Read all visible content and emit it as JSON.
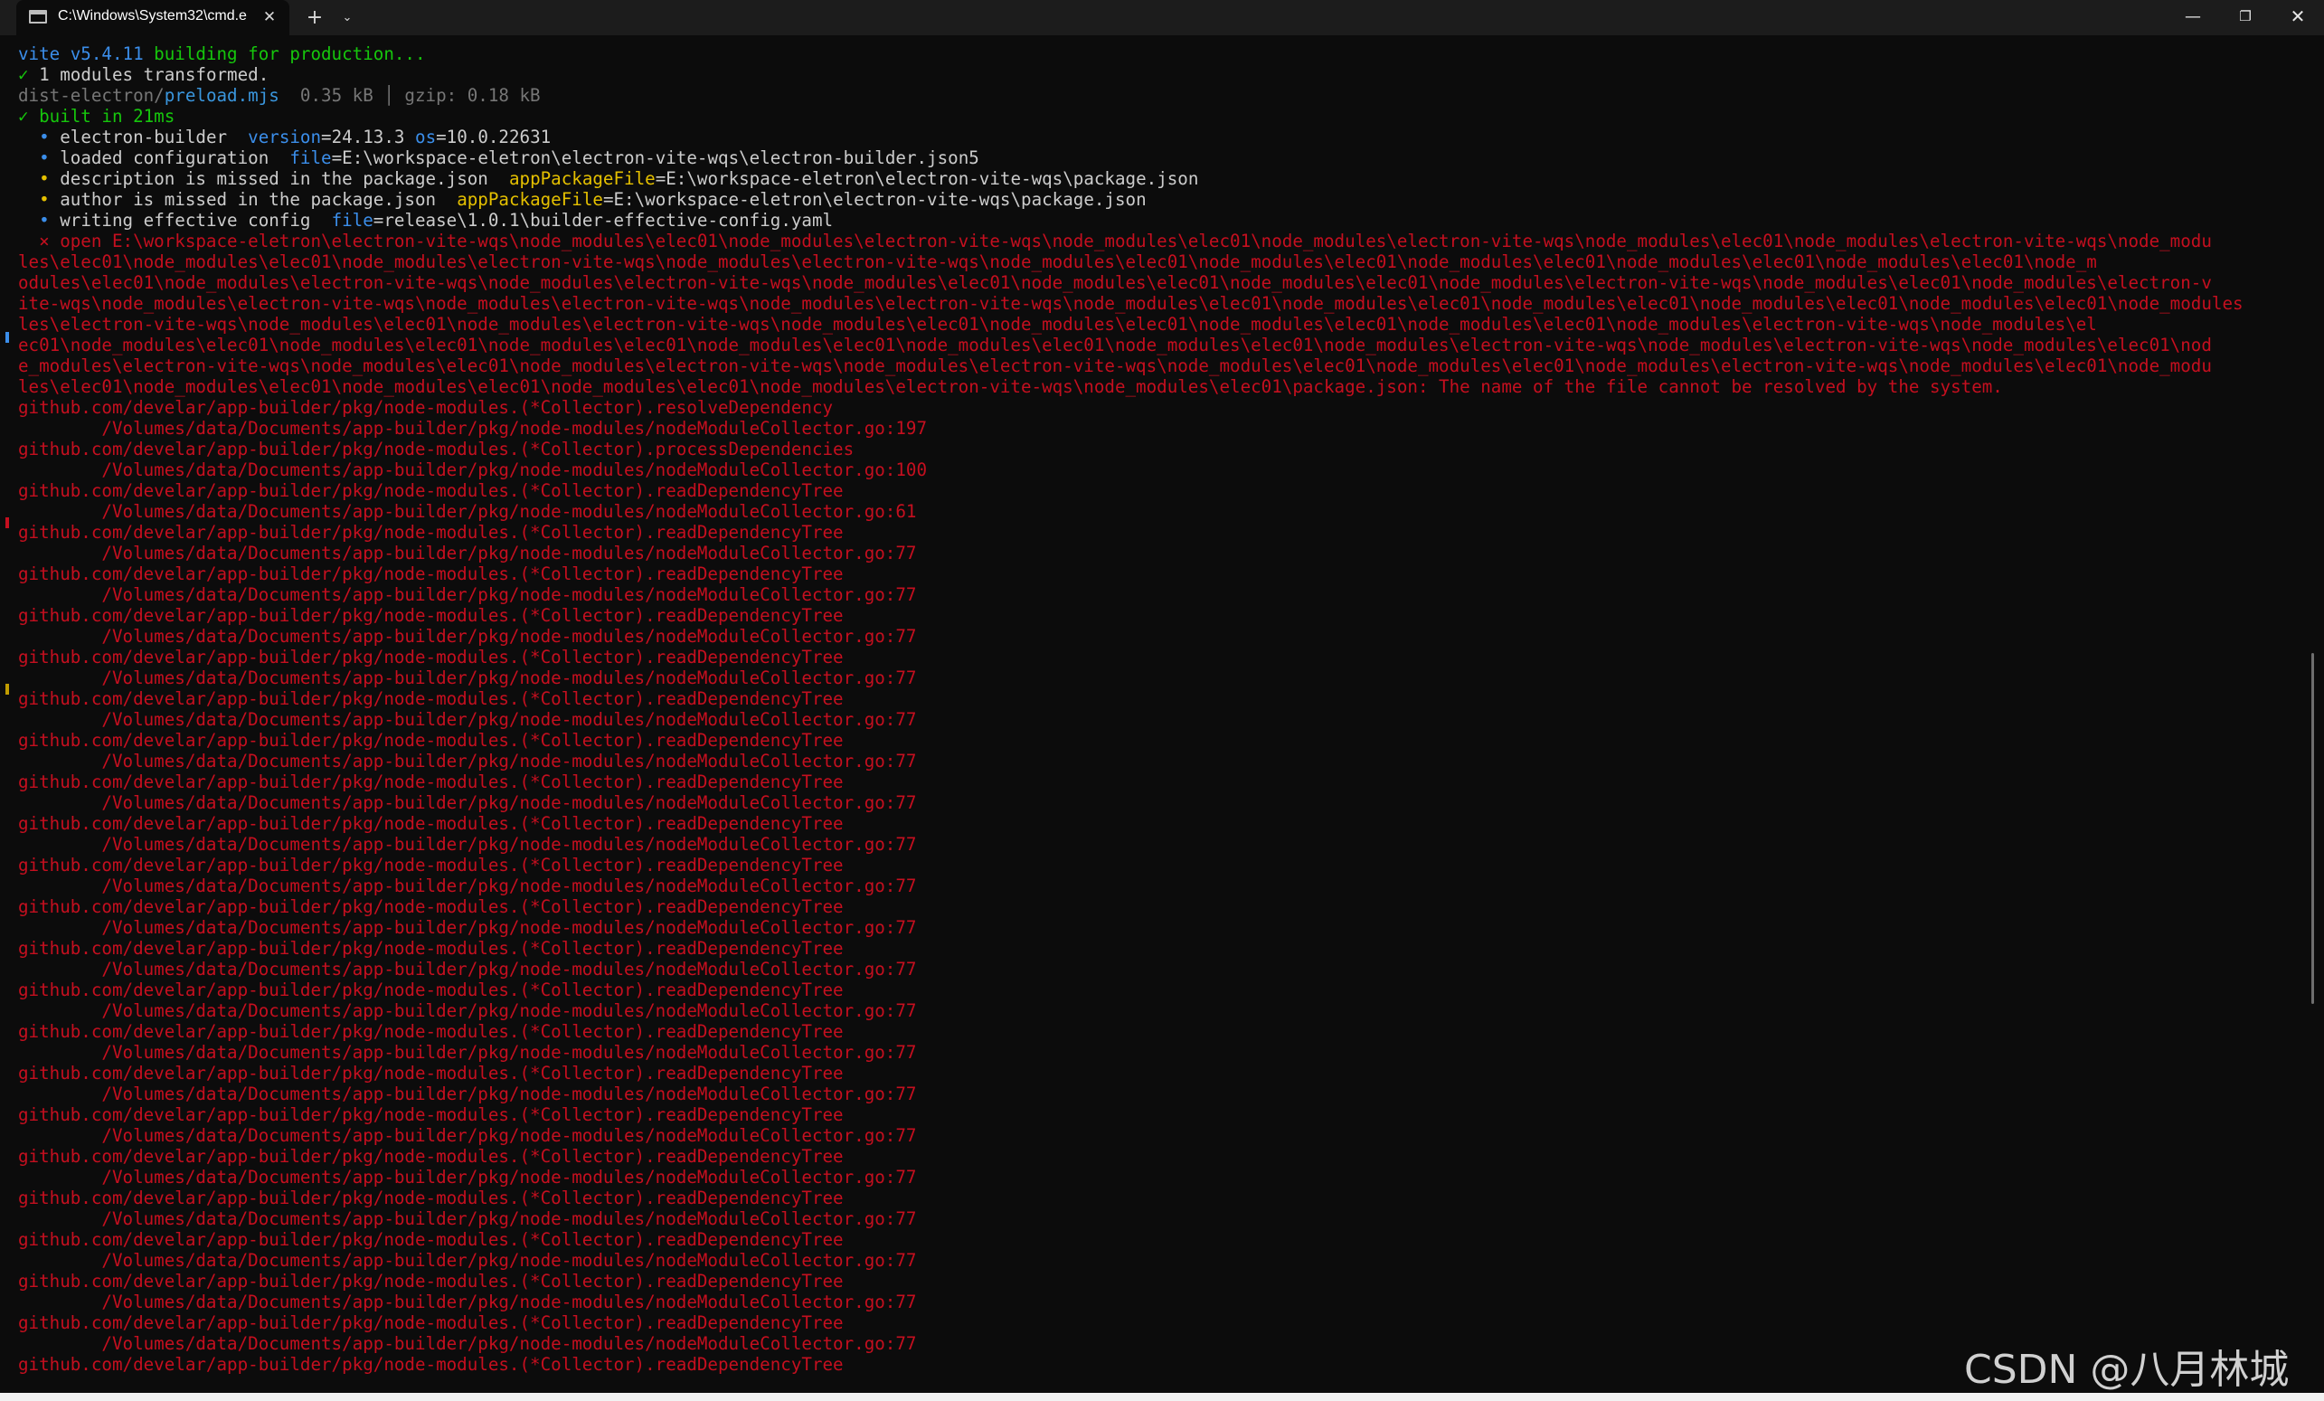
{
  "window": {
    "tab_title": "C:\\Windows\\System32\\cmd.e",
    "tab_close_glyph": "✕",
    "new_tab_glyph": "+",
    "dropdown_glyph": "⌄",
    "minimize_glyph": "—",
    "maximize_glyph": "❐",
    "close_glyph": "✕"
  },
  "colors": {
    "background": "#0c0c0c",
    "titlebar": "#1c1c1c",
    "error_red": "#c50f1f",
    "info_blue": "#3b8eea",
    "success_green": "#16c60c",
    "warn_yellow": "#e5c000"
  },
  "terminal": {
    "build": [
      {
        "a": "vite v5.4.11",
        "b": " building for production..."
      },
      {
        "a": "✓",
        "b": " 1 modules transformed."
      },
      {
        "a": "dist-electron/",
        "b": "preload.mjs",
        "c": "  0.35 kB │ gzip: 0.18 kB"
      },
      {
        "a": "✓ built in 21ms"
      }
    ],
    "builder": [
      {
        "bullet": "•",
        "text": " electron-builder  ",
        "k1": "version",
        "v1": "=24.13.3 ",
        "k2": "os",
        "v2": "=10.0.22631",
        "level": "info"
      },
      {
        "bullet": "•",
        "text": " loaded configuration  ",
        "k1": "file",
        "v1": "=E:\\workspace-eletron\\electron-vite-wqs\\electron-builder.json5",
        "level": "info"
      },
      {
        "bullet": "•",
        "text": " description is missed in the package.json  ",
        "k1": "appPackageFile",
        "v1": "=E:\\workspace-eletron\\electron-vite-wqs\\package.json",
        "level": "warn"
      },
      {
        "bullet": "•",
        "text": " author is missed in the package.json  ",
        "k1": "appPackageFile",
        "v1": "=E:\\workspace-eletron\\electron-vite-wqs\\package.json",
        "level": "warn"
      },
      {
        "bullet": "•",
        "text": " writing effective config  ",
        "k1": "file",
        "v1": "=release\\1.0.1\\builder-effective-config.yaml",
        "level": "info"
      }
    ],
    "error_lines": [
      "  ⨯ open E:\\workspace-eletron\\electron-vite-wqs\\node_modules\\elec01\\node_modules\\electron-vite-wqs\\node_modules\\elec01\\node_modules\\electron-vite-wqs\\node_modules\\elec01\\node_modules\\electron-vite-wqs\\node_modu",
      "les\\elec01\\node_modules\\elec01\\node_modules\\electron-vite-wqs\\node_modules\\electron-vite-wqs\\node_modules\\elec01\\node_modules\\elec01\\node_modules\\elec01\\node_modules\\elec01\\node_modules\\elec01\\node_m",
      "odules\\elec01\\node_modules\\electron-vite-wqs\\node_modules\\electron-vite-wqs\\node_modules\\elec01\\node_modules\\elec01\\node_modules\\elec01\\node_modules\\electron-vite-wqs\\node_modules\\elec01\\node_modules\\electron-v",
      "ite-wqs\\node_modules\\electron-vite-wqs\\node_modules\\electron-vite-wqs\\node_modules\\electron-vite-wqs\\node_modules\\elec01\\node_modules\\elec01\\node_modules\\elec01\\node_modules\\elec01\\node_modules\\elec01\\node_modules",
      "les\\electron-vite-wqs\\node_modules\\elec01\\node_modules\\electron-vite-wqs\\node_modules\\elec01\\node_modules\\elec01\\node_modules\\elec01\\node_modules\\elec01\\node_modules\\electron-vite-wqs\\node_modules\\el",
      "ec01\\node_modules\\elec01\\node_modules\\elec01\\node_modules\\elec01\\node_modules\\elec01\\node_modules\\elec01\\node_modules\\elec01\\node_modules\\electron-vite-wqs\\node_modules\\electron-vite-wqs\\node_modules\\elec01\\nod",
      "e_modules\\electron-vite-wqs\\node_modules\\elec01\\node_modules\\electron-vite-wqs\\node_modules\\electron-vite-wqs\\node_modules\\elec01\\node_modules\\elec01\\node_modules\\electron-vite-wqs\\node_modules\\elec01\\node_modu",
      "les\\elec01\\node_modules\\elec01\\node_modules\\elec01\\node_modules\\elec01\\node_modules\\electron-vite-wqs\\node_modules\\elec01\\package.json: The name of the file cannot be resolved by the system."
    ],
    "stack": [
      {
        "fn": "github.com/develar/app-builder/pkg/node-modules.(*Collector).resolveDependency",
        "loc": "        /Volumes/data/Documents/app-builder/pkg/node-modules/nodeModuleCollector.go:197"
      },
      {
        "fn": "github.com/develar/app-builder/pkg/node-modules.(*Collector).processDependencies",
        "loc": "        /Volumes/data/Documents/app-builder/pkg/node-modules/nodeModuleCollector.go:100"
      },
      {
        "fn": "github.com/develar/app-builder/pkg/node-modules.(*Collector).readDependencyTree",
        "loc": "        /Volumes/data/Documents/app-builder/pkg/node-modules/nodeModuleCollector.go:61"
      },
      {
        "fn": "github.com/develar/app-builder/pkg/node-modules.(*Collector).readDependencyTree",
        "loc": "        /Volumes/data/Documents/app-builder/pkg/node-modules/nodeModuleCollector.go:77"
      },
      {
        "fn": "github.com/develar/app-builder/pkg/node-modules.(*Collector).readDependencyTree",
        "loc": "        /Volumes/data/Documents/app-builder/pkg/node-modules/nodeModuleCollector.go:77"
      },
      {
        "fn": "github.com/develar/app-builder/pkg/node-modules.(*Collector).readDependencyTree",
        "loc": "        /Volumes/data/Documents/app-builder/pkg/node-modules/nodeModuleCollector.go:77"
      },
      {
        "fn": "github.com/develar/app-builder/pkg/node-modules.(*Collector).readDependencyTree",
        "loc": "        /Volumes/data/Documents/app-builder/pkg/node-modules/nodeModuleCollector.go:77"
      },
      {
        "fn": "github.com/develar/app-builder/pkg/node-modules.(*Collector).readDependencyTree",
        "loc": "        /Volumes/data/Documents/app-builder/pkg/node-modules/nodeModuleCollector.go:77"
      },
      {
        "fn": "github.com/develar/app-builder/pkg/node-modules.(*Collector).readDependencyTree",
        "loc": "        /Volumes/data/Documents/app-builder/pkg/node-modules/nodeModuleCollector.go:77"
      },
      {
        "fn": "github.com/develar/app-builder/pkg/node-modules.(*Collector).readDependencyTree",
        "loc": "        /Volumes/data/Documents/app-builder/pkg/node-modules/nodeModuleCollector.go:77"
      },
      {
        "fn": "github.com/develar/app-builder/pkg/node-modules.(*Collector).readDependencyTree",
        "loc": "        /Volumes/data/Documents/app-builder/pkg/node-modules/nodeModuleCollector.go:77"
      },
      {
        "fn": "github.com/develar/app-builder/pkg/node-modules.(*Collector).readDependencyTree",
        "loc": "        /Volumes/data/Documents/app-builder/pkg/node-modules/nodeModuleCollector.go:77"
      },
      {
        "fn": "github.com/develar/app-builder/pkg/node-modules.(*Collector).readDependencyTree",
        "loc": "        /Volumes/data/Documents/app-builder/pkg/node-modules/nodeModuleCollector.go:77"
      },
      {
        "fn": "github.com/develar/app-builder/pkg/node-modules.(*Collector).readDependencyTree",
        "loc": "        /Volumes/data/Documents/app-builder/pkg/node-modules/nodeModuleCollector.go:77"
      },
      {
        "fn": "github.com/develar/app-builder/pkg/node-modules.(*Collector).readDependencyTree",
        "loc": "        /Volumes/data/Documents/app-builder/pkg/node-modules/nodeModuleCollector.go:77"
      },
      {
        "fn": "github.com/develar/app-builder/pkg/node-modules.(*Collector).readDependencyTree",
        "loc": "        /Volumes/data/Documents/app-builder/pkg/node-modules/nodeModuleCollector.go:77"
      },
      {
        "fn": "github.com/develar/app-builder/pkg/node-modules.(*Collector).readDependencyTree",
        "loc": "        /Volumes/data/Documents/app-builder/pkg/node-modules/nodeModuleCollector.go:77"
      },
      {
        "fn": "github.com/develar/app-builder/pkg/node-modules.(*Collector).readDependencyTree",
        "loc": "        /Volumes/data/Documents/app-builder/pkg/node-modules/nodeModuleCollector.go:77"
      },
      {
        "fn": "github.com/develar/app-builder/pkg/node-modules.(*Collector).readDependencyTree",
        "loc": "        /Volumes/data/Documents/app-builder/pkg/node-modules/nodeModuleCollector.go:77"
      },
      {
        "fn": "github.com/develar/app-builder/pkg/node-modules.(*Collector).readDependencyTree",
        "loc": "        /Volumes/data/Documents/app-builder/pkg/node-modules/nodeModuleCollector.go:77"
      },
      {
        "fn": "github.com/develar/app-builder/pkg/node-modules.(*Collector).readDependencyTree",
        "loc": "        /Volumes/data/Documents/app-builder/pkg/node-modules/nodeModuleCollector.go:77"
      },
      {
        "fn": "github.com/develar/app-builder/pkg/node-modules.(*Collector).readDependencyTree",
        "loc": "        /Volumes/data/Documents/app-builder/pkg/node-modules/nodeModuleCollector.go:77"
      },
      {
        "fn": "github.com/develar/app-builder/pkg/node-modules.(*Collector).readDependencyTree",
        "loc": "        /Volumes/data/Documents/app-builder/pkg/node-modules/nodeModuleCollector.go:77"
      },
      {
        "fn": "github.com/develar/app-builder/pkg/node-modules.(*Collector).readDependencyTree",
        "loc": ""
      }
    ]
  },
  "watermark": "CSDN @八月林城"
}
